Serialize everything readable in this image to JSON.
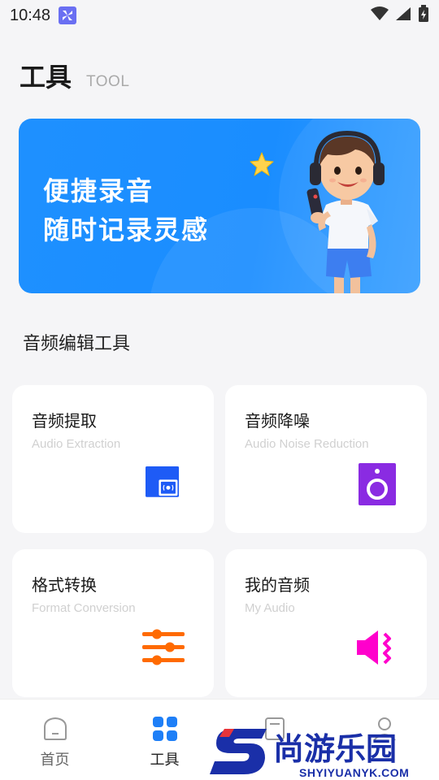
{
  "status_bar": {
    "time": "10:48"
  },
  "header": {
    "title": "工具",
    "subtitle": "TOOL"
  },
  "banner": {
    "line1": "便捷录音",
    "line2": "随时记录灵感"
  },
  "section": {
    "title": "音频编辑工具"
  },
  "tools": [
    {
      "title": "音频提取",
      "subtitle": "Audio Extraction",
      "icon": "audio-extraction-icon",
      "color": "#1e5bf6"
    },
    {
      "title": "音频降噪",
      "subtitle": "Audio Noise Reduction",
      "icon": "speaker-icon",
      "color": "#8a2be2"
    },
    {
      "title": "格式转换",
      "subtitle": "Format Conversion",
      "icon": "sliders-icon",
      "color": "#ff6a00"
    },
    {
      "title": "我的音频",
      "subtitle": "My Audio",
      "icon": "volume-icon",
      "color": "#ff00cc"
    }
  ],
  "nav": [
    {
      "label": "首页",
      "icon": "home-icon"
    },
    {
      "label": "工具",
      "icon": "grid-icon",
      "active": true
    },
    {
      "label": "",
      "icon": "document-icon"
    },
    {
      "label": "",
      "icon": "profile-icon"
    }
  ],
  "watermark": {
    "brand": "尚游乐园",
    "url": "SHYIYUANYK.COM"
  }
}
